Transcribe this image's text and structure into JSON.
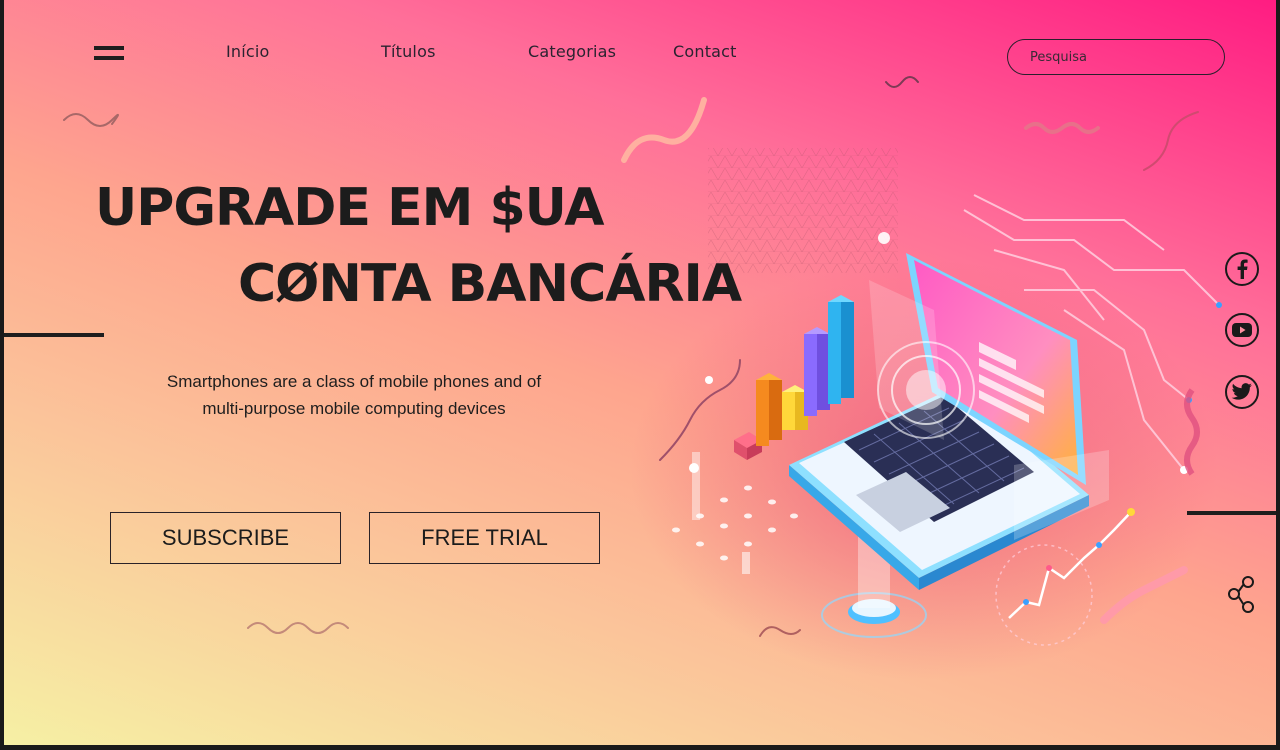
{
  "nav": {
    "menu_icon": "hamburger-menu-icon",
    "links": [
      "Início",
      "Títulos",
      "Categorias",
      "Contact"
    ]
  },
  "search": {
    "placeholder": "Pesquisa"
  },
  "hero": {
    "headline_line1": "UPGRADE EM $UA",
    "headline_line2": "CØNTA BANCÁRIA",
    "subtitle_line1": "Smartphones are a class of mobile phones and of",
    "subtitle_line2": "multi-purpose mobile computing devices",
    "subscribe_label": "SUBSCRIBE",
    "trial_label": "FREE TRIAL"
  },
  "social": {
    "icons": [
      "facebook-icon",
      "youtube-icon",
      "twitter-icon",
      "share-icon"
    ]
  },
  "colors": {
    "gradient_start": "#f6f0a4",
    "gradient_mid": "#fea58e",
    "gradient_end": "#ff1c82",
    "text_dark": "#1c1c1c"
  }
}
